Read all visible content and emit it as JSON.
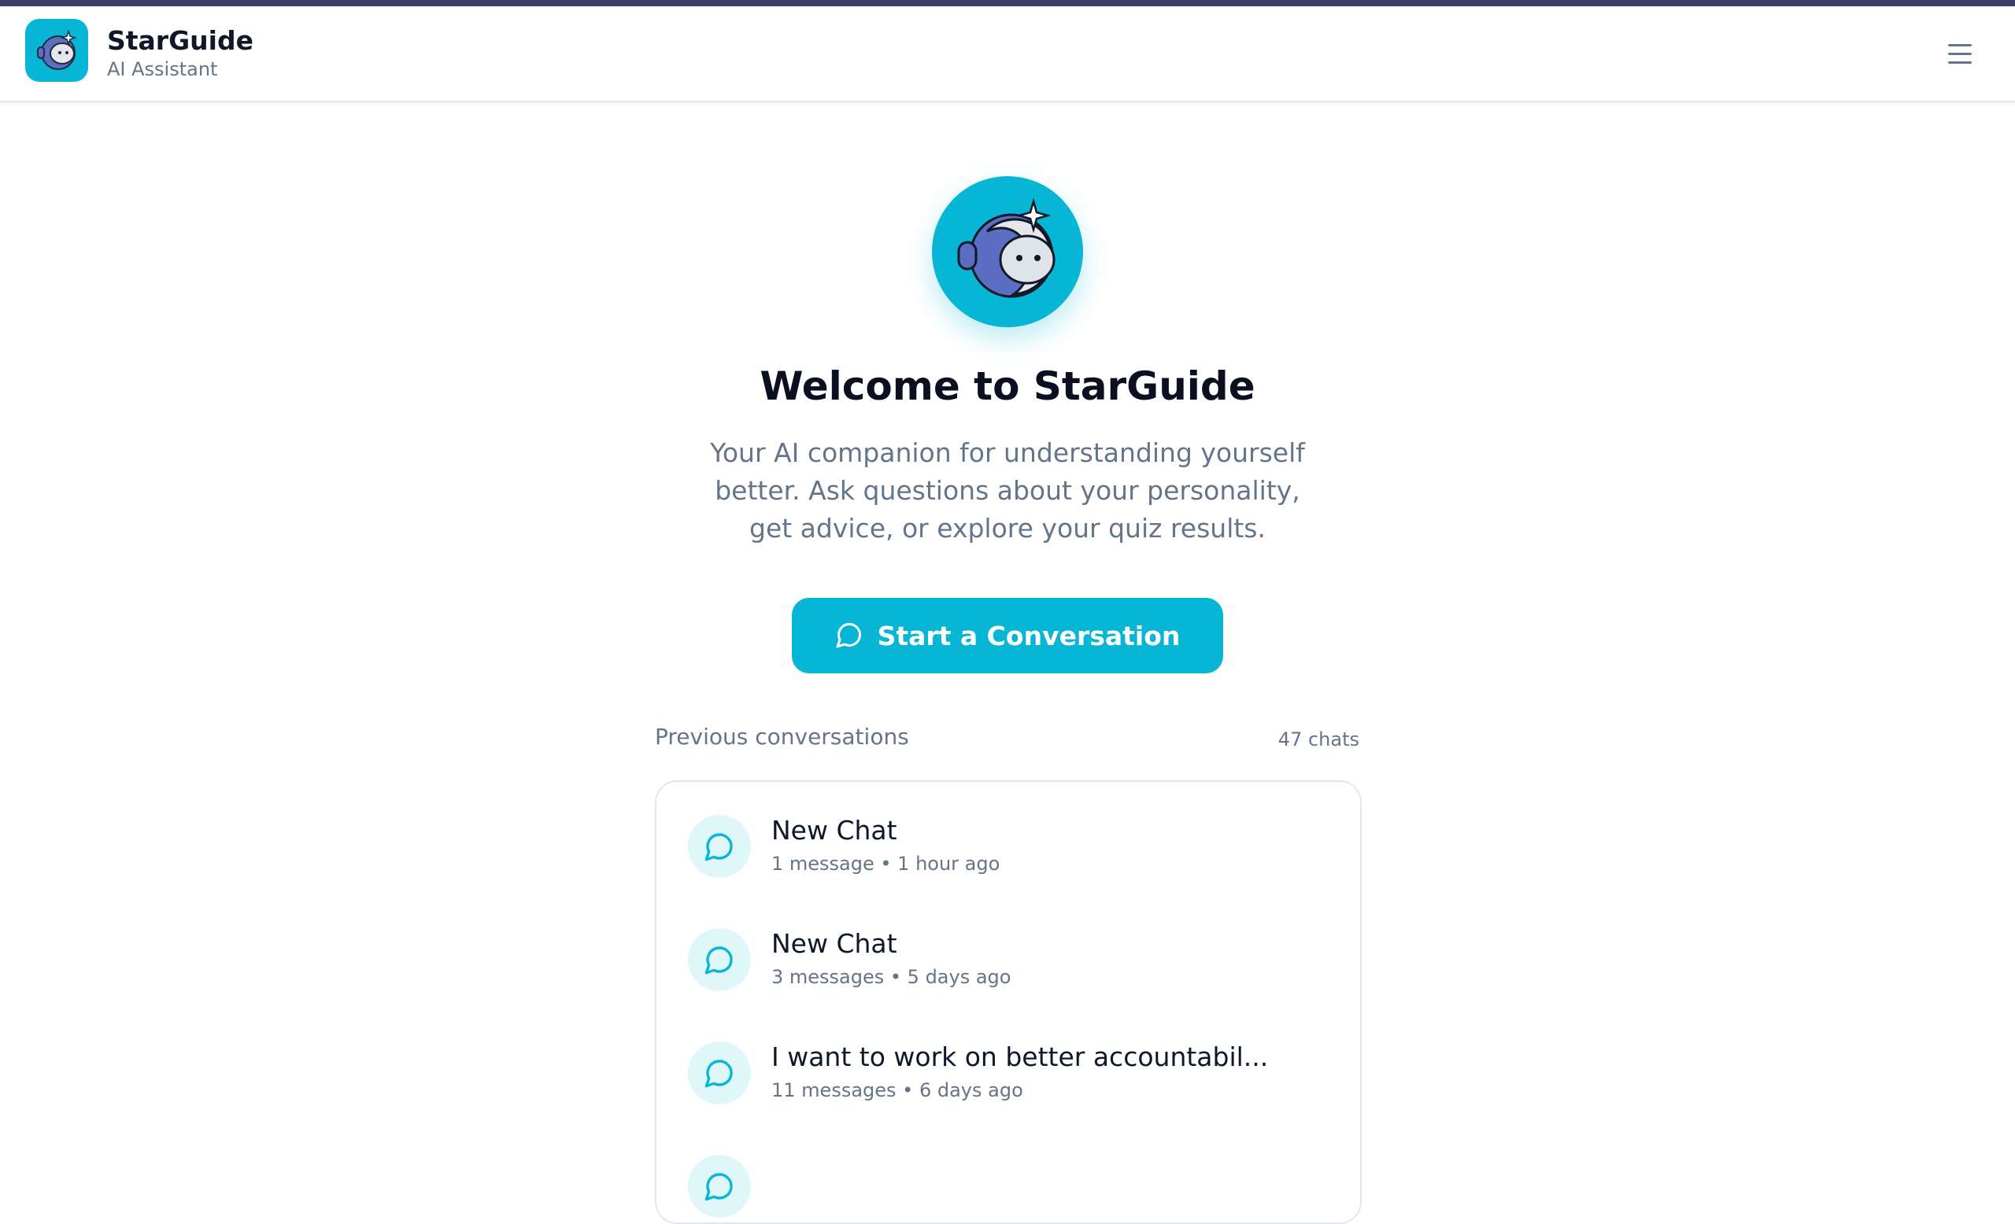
{
  "header": {
    "title": "StarGuide",
    "subtitle": "AI Assistant",
    "logo_icon": "robot-astronaut-icon",
    "menu_icon": "hamburger-menu-icon"
  },
  "welcome": {
    "title": "Welcome to StarGuide",
    "description": "Your AI companion for understanding yourself better. Ask questions about your personality, get advice, or explore your quiz results.",
    "start_button_label": "Start a Conversation",
    "start_button_icon": "chat-bubble-icon"
  },
  "conversations": {
    "section_label": "Previous conversations",
    "count_label": "47 chats",
    "items": [
      {
        "title": "New Chat",
        "meta": "1 message • 1 hour ago"
      },
      {
        "title": "New Chat",
        "meta": "3 messages • 5 days ago"
      },
      {
        "title": "I want to work on better accountabil...",
        "meta": "11 messages • 6 days ago"
      },
      {
        "title": "",
        "meta": ""
      }
    ]
  },
  "colors": {
    "accent": "#06b6d4",
    "top_bar": "#3f3e6b",
    "text_primary": "#0f172a",
    "text_muted": "#64748b",
    "icon_bg": "#e0f7fa"
  }
}
